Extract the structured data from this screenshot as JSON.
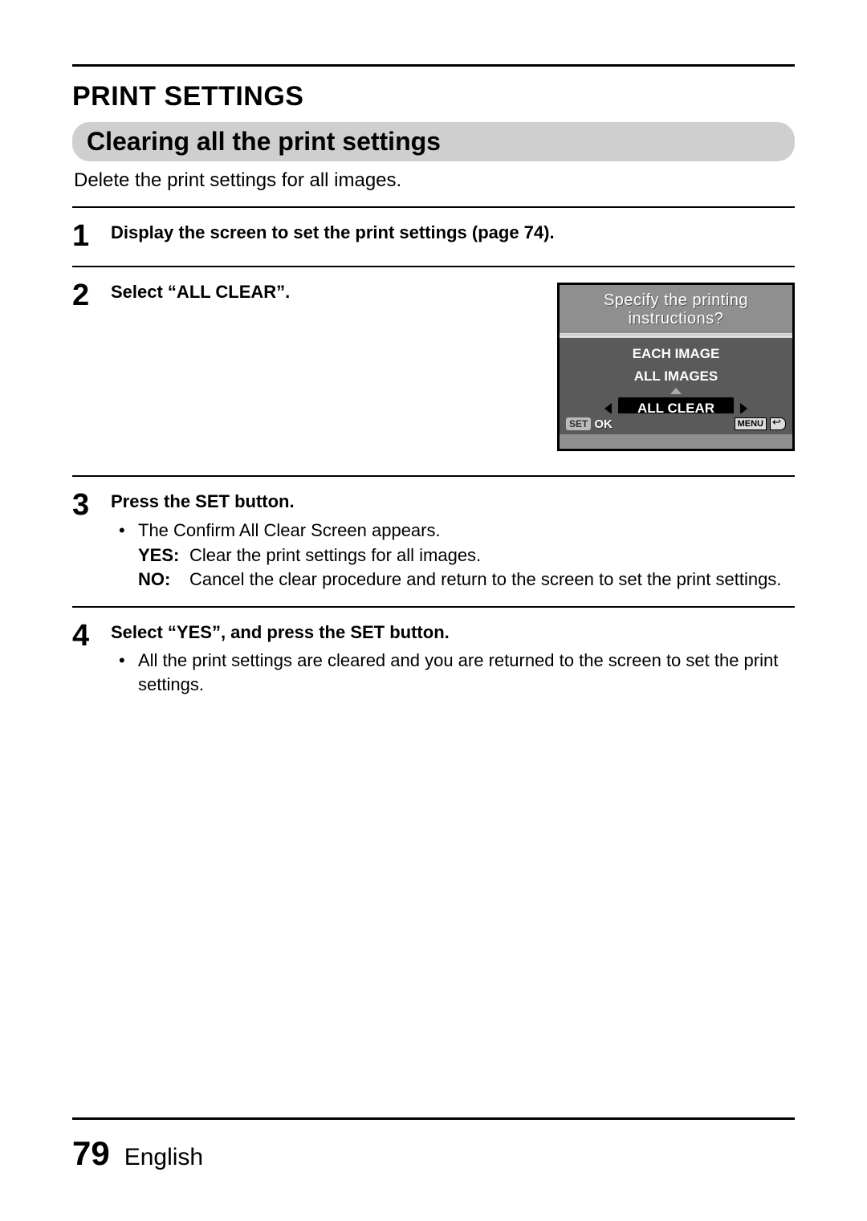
{
  "title": "PRINT SETTINGS",
  "subtitle": "Clearing all the print settings",
  "intro": "Delete the print settings for all images.",
  "steps": {
    "s1": {
      "num": "1",
      "lead": "Display the screen to set the print settings (page 74)."
    },
    "s2": {
      "num": "2",
      "lead": "Select “ALL CLEAR”."
    },
    "s3": {
      "num": "3",
      "lead": "Press the SET button.",
      "bullet": "The Confirm All Clear Screen appears.",
      "yes_k": "YES:",
      "yes_v": "Clear the print settings for all images.",
      "no_k": "NO:",
      "no_v": "Cancel the clear procedure and return to the screen to set the print settings."
    },
    "s4": {
      "num": "4",
      "lead": "Select “YES”, and press the SET button.",
      "bullet": "All the print settings are cleared and you are returned to the screen to set the print settings."
    }
  },
  "lcd": {
    "head1": "Specify the printing",
    "head2": "instructions?",
    "opt1": "EACH IMAGE",
    "opt2": "ALL IMAGES",
    "opt3": "ALL CLEAR",
    "set": "SET",
    "ok": "OK",
    "menu": "MENU"
  },
  "footer": {
    "page": "79",
    "lang": "English"
  }
}
